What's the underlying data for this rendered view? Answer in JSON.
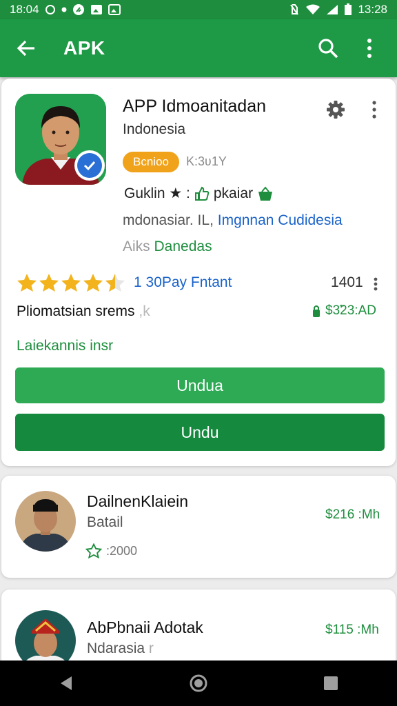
{
  "status_bar": {
    "time_left": "18:04",
    "time_right": "13:28"
  },
  "app_bar": {
    "title": "APK"
  },
  "app": {
    "name": "APP Idmoanitadan",
    "subtitle": "Indonesia",
    "badge": "Bcnioo",
    "badge_meta": "K:3ʋ1Y",
    "developer": "Guklin ★ : ",
    "developer_suffix": "pkaiar",
    "location_prefix": "mdonasiar. IL, ",
    "location_link": "Imgnnan Cudidesia",
    "category_prefix": "Aiks ",
    "category": "Danedas",
    "rating_stars": 4.5,
    "rating_text": "1 30Pay Fntant",
    "rating_count": "1401",
    "promo": "Pliomatsian srems",
    "promo_faded": " ,k",
    "price": "$3̃23:AD",
    "green_link": "Laiekannis insr",
    "button_primary": "Undua",
    "button_secondary": "Undu"
  },
  "list": [
    {
      "title": "DailnenKlaiein",
      "subtitle": "Batail",
      "meta": ":2000",
      "price": "$216 :Mh"
    },
    {
      "title": "AbPbnaii Adotak",
      "subtitle": "Ndarasia",
      "subtitle_faded": " r",
      "price": "$115 :Mh"
    }
  ],
  "colors": {
    "primary": "#1e9a47",
    "button_light": "#2eaa55",
    "button_dark": "#158a3e",
    "badge": "#f0a21a",
    "link_blue": "#1a63c9",
    "star": "#f2b31c"
  }
}
